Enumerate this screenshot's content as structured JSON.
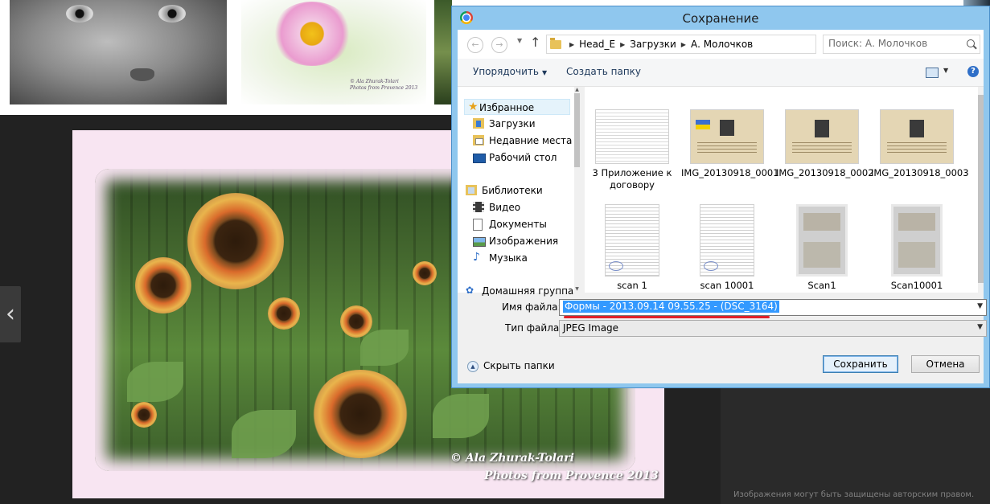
{
  "background": {
    "thumbnail_credit": [
      "© Ala Zhurak-Tolari",
      "Photos from Provence 2013"
    ],
    "photo_watermark": [
      "© Ala Zhurak-Tolari",
      "Photos from Provence 2013"
    ],
    "prev_arrow": "‹",
    "copyright_note": "Изображения могут быть защищены авторским правом."
  },
  "dialog": {
    "title": "Сохранение",
    "nav": {
      "back": "←",
      "forward": "→",
      "up": "↑",
      "breadcrumb": [
        "Head_E",
        "Загрузки",
        "А. Молочков"
      ],
      "search_placeholder": "Поиск: А. Молочков"
    },
    "toolbar": {
      "organize": "Упорядочить",
      "new_folder": "Создать папку",
      "help": "?"
    },
    "sidebar": {
      "favorites": "Избранное",
      "downloads": "Загрузки",
      "recent": "Недавние места",
      "desktop": "Рабочий стол",
      "libraries": "Библиотеки",
      "video": "Видео",
      "documents": "Документы",
      "images": "Изображения",
      "music": "Музыка",
      "homegroup": "Домашняя группа"
    },
    "files": [
      {
        "name": "3 Приложение к договору"
      },
      {
        "name": "IMG_20130918_0001"
      },
      {
        "name": "IMG_20130918_0002"
      },
      {
        "name": "IMG_20130918_0003"
      },
      {
        "name": "scan 1"
      },
      {
        "name": "scan 10001"
      },
      {
        "name": "Scan1"
      },
      {
        "name": "Scan10001"
      }
    ],
    "form": {
      "filename_label": "Имя файла:",
      "filename_value": "Формы - 2013.09.14 09.55.25 - (DSC_3164)",
      "filetype_label": "Тип файла:",
      "filetype_value": "JPEG Image",
      "hide_folders": "Скрыть папки",
      "save": "Сохранить",
      "cancel": "Отмена"
    }
  },
  "colors": {
    "selection": "#3399ff",
    "underline": "#e0202a",
    "dialog_frame": "#8fc7ee"
  }
}
